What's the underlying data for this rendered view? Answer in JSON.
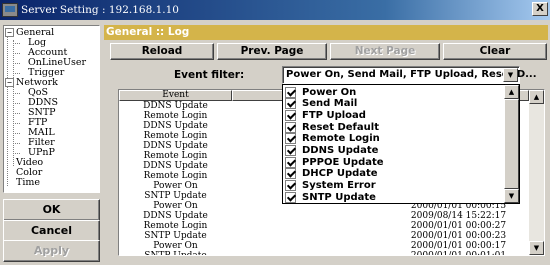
{
  "window": {
    "title": "Server Setting : 192.168.1.10",
    "close_label": "X"
  },
  "tree": {
    "items": [
      {
        "label": "General",
        "level": 0,
        "expander": "−"
      },
      {
        "label": "Log",
        "level": 1
      },
      {
        "label": "Account",
        "level": 1
      },
      {
        "label": "OnLineUser",
        "level": 1
      },
      {
        "label": "Trigger",
        "level": 1
      },
      {
        "label": "Network",
        "level": 0,
        "expander": "−"
      },
      {
        "label": "QoS",
        "level": 1
      },
      {
        "label": "DDNS",
        "level": 1
      },
      {
        "label": "SNTP",
        "level": 1
      },
      {
        "label": "FTP",
        "level": 1
      },
      {
        "label": "MAIL",
        "level": 1
      },
      {
        "label": "Filter",
        "level": 1
      },
      {
        "label": "UPnP",
        "level": 1
      },
      {
        "label": "Video",
        "level": 0
      },
      {
        "label": "Color",
        "level": 0
      },
      {
        "label": "Time",
        "level": 0
      }
    ]
  },
  "left_buttons": {
    "ok": "OK",
    "cancel": "Cancel",
    "apply": "Apply"
  },
  "header": {
    "title": "General :: Log"
  },
  "toolbar": {
    "reload": "Reload",
    "prev_page": "Prev. Page",
    "next_page": "Next Page",
    "clear": "Clear"
  },
  "filter": {
    "label": "Event filter:",
    "value": "Power On, Send Mail, FTP Upload, Reset D...",
    "options": [
      {
        "label": "Power On",
        "checked": true
      },
      {
        "label": "Send Mail",
        "checked": true
      },
      {
        "label": "FTP Upload",
        "checked": true
      },
      {
        "label": "Reset Default",
        "checked": true
      },
      {
        "label": "Remote Login",
        "checked": true
      },
      {
        "label": "DDNS Update",
        "checked": true
      },
      {
        "label": "PPPOE Update",
        "checked": true
      },
      {
        "label": "DHCP Update",
        "checked": true
      },
      {
        "label": "System Error",
        "checked": true
      },
      {
        "label": "SNTP Update",
        "checked": true
      }
    ]
  },
  "log_table": {
    "columns": [
      "Event",
      "T",
      ""
    ],
    "rows": [
      [
        "DDNS Update",
        "",
        ""
      ],
      [
        "Remote Login",
        "",
        ""
      ],
      [
        "DDNS Update",
        "",
        ""
      ],
      [
        "Remote Login",
        "",
        ""
      ],
      [
        "DDNS Update",
        "",
        ""
      ],
      [
        "Remote Login",
        "",
        ""
      ],
      [
        "DDNS Update",
        "",
        ""
      ],
      [
        "Remote Login",
        "",
        ""
      ],
      [
        "Power On",
        "",
        ""
      ],
      [
        "SNTP Update",
        "",
        ""
      ],
      [
        "Power On",
        "",
        "2000/01/01 00:00:15"
      ],
      [
        "DDNS Update",
        "",
        "2009/08/14 15:22:17"
      ],
      [
        "Remote Login",
        "",
        "2000/01/01 00:00:27"
      ],
      [
        "SNTP Update",
        "",
        "2000/01/01 00:00:23"
      ],
      [
        "Power On",
        "",
        "2000/01/01 00:00:17"
      ],
      [
        "SNTP Update",
        "",
        "2000/01/01 00:01:01"
      ]
    ]
  }
}
